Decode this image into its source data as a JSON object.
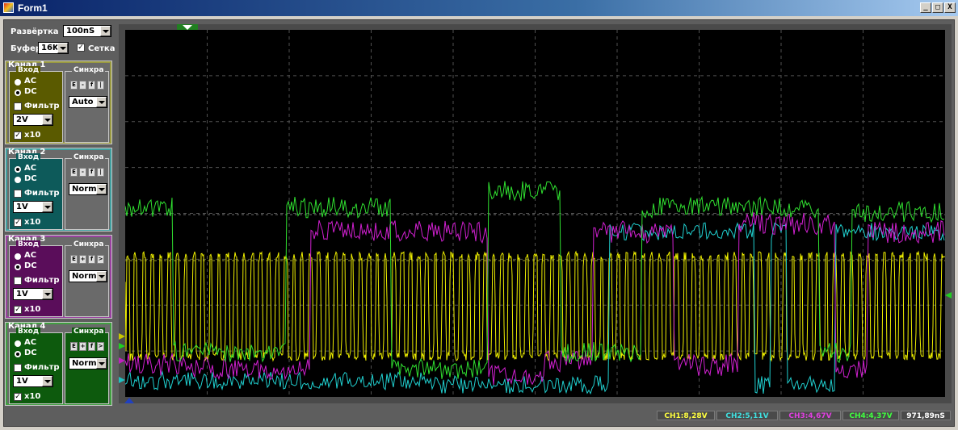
{
  "window": {
    "title": "Form1",
    "buttons": [
      "_",
      "□",
      "X"
    ]
  },
  "controls": {
    "sweep_label": "Развёртка",
    "sweep_value": "100nS",
    "buffer_label": "Буфер",
    "buffer_value": "16K",
    "grid_label": "Сетка",
    "grid_checked": true
  },
  "channels": [
    {
      "title": "Канал 1",
      "input_label": "Вход",
      "ac": "AC",
      "dc": "DC",
      "filter": "Фильтр",
      "volts": "2V",
      "x10": "x10",
      "sync_label": "Синхра",
      "sync_buttons": [
        "E",
        "-",
        "f",
        "|"
      ],
      "sync_mode": "Auto",
      "color": "#5a5a00",
      "selected": "dc"
    },
    {
      "title": "Канал 2",
      "input_label": "Вход",
      "ac": "AC",
      "dc": "DC",
      "filter": "Фильтр",
      "volts": "1V",
      "x10": "x10",
      "sync_label": "Синхра",
      "sync_buttons": [
        "E",
        "-",
        "f",
        "|"
      ],
      "sync_mode": "Normal",
      "color": "#0d5a5a",
      "selected": "ac"
    },
    {
      "title": "Канал 3",
      "input_label": "Вход",
      "ac": "AC",
      "dc": "DC",
      "filter": "Фильтр",
      "volts": "1V",
      "x10": "x10",
      "sync_label": "Синхра",
      "sync_buttons": [
        "E",
        "+",
        "f",
        ">"
      ],
      "sync_mode": "Normal",
      "color": "#5a0d5a",
      "selected": "dc"
    },
    {
      "title": "Канал 4",
      "input_label": "Вход",
      "ac": "AC",
      "dc": "DC",
      "filter": "Фильтр",
      "volts": "1V",
      "x10": "x10",
      "sync_label": "Синхра",
      "sync_buttons": [
        "E",
        "+",
        "f",
        ">"
      ],
      "sync_mode": "Normal",
      "color": "#0d5a0d",
      "selected": "dc"
    }
  ],
  "status": [
    {
      "text": "CH1:8,28V",
      "color": "#ffff40"
    },
    {
      "text": "CH2:5,11V",
      "color": "#40e0e0"
    },
    {
      "text": "CH3:4,67V",
      "color": "#e040e0"
    },
    {
      "text": "CH4:4,37V",
      "color": "#40ff40"
    },
    {
      "text": "971,89nS",
      "color": "#ffffff"
    }
  ],
  "trace_colors": {
    "ch1": "#f0f000",
    "ch2": "#20d0d0",
    "ch3": "#d020d0",
    "ch4": "#30e030"
  },
  "icons": {
    "trigger_marker": "triangle-down-icon"
  }
}
